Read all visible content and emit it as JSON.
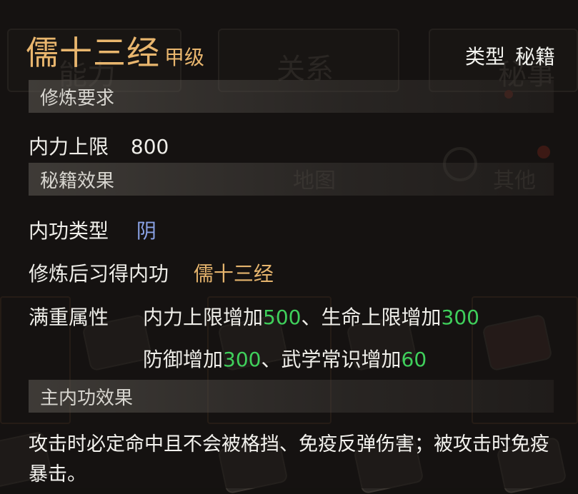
{
  "item": {
    "name": "儒十三经",
    "grade": "甲级",
    "type_label": "类型",
    "type_value": "秘籍"
  },
  "sections": {
    "requirement": "修炼要求",
    "effect": "秘籍效果",
    "main_effect": "主内功效果"
  },
  "requirement": {
    "label": "内力上限",
    "value": "800"
  },
  "effect": {
    "skill_type_label": "内功类型",
    "skill_type_value": "阴",
    "learned_label": "修炼后习得内功",
    "learned_value": "儒十三经",
    "full_label": "满重属性",
    "full_line1": {
      "a_label": "内力上限增加",
      "a_value": "500",
      "sep": "、",
      "b_label": "生命上限增加",
      "b_value": "300"
    },
    "full_line2": {
      "a_label": "防御增加",
      "a_value": "300",
      "sep": "、",
      "b_label": "武学常识增加",
      "b_value": "60"
    }
  },
  "main_effect_text": "攻击时必定命中且不会被格挡、免疫反弹伤害；被攻击时免疫暴击。",
  "background": {
    "tab_left": "能力",
    "tab_mid": "关系",
    "tab_right": "秘事",
    "map_label": "地图",
    "other_label": "其他"
  },
  "colors": {
    "title": "#e9b66e",
    "yin_type": "#8aa2e6",
    "learned_skill": "#e5b46d",
    "numbers": "#3fcf5b"
  }
}
